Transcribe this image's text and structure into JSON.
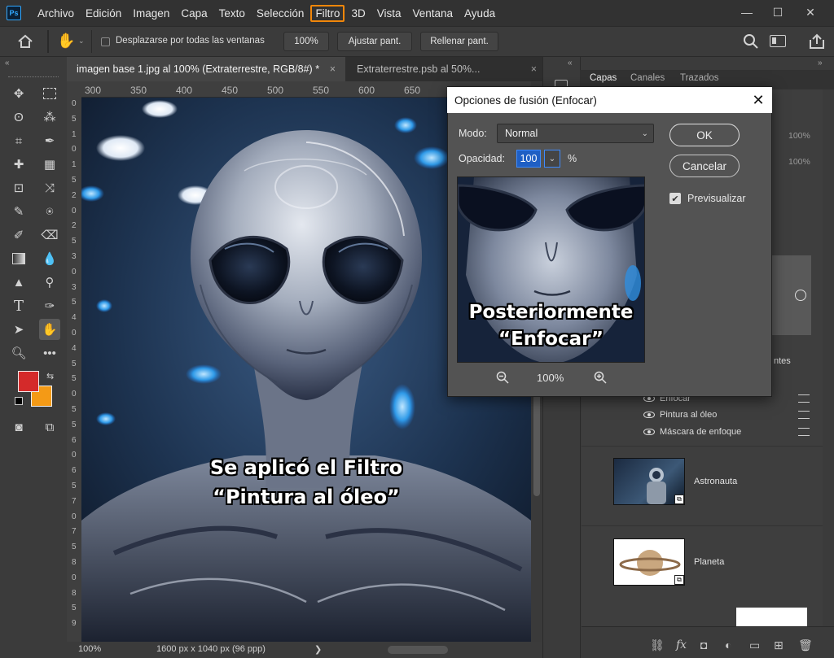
{
  "app": {
    "logo": "Ps",
    "menu": [
      "Archivo",
      "Edición",
      "Imagen",
      "Capa",
      "Texto",
      "Selección",
      "Filtro",
      "3D",
      "Vista",
      "Ventana",
      "Ayuda"
    ],
    "highlighted_menu": "Filtro",
    "window_controls": {
      "minimize": "—",
      "maximize": "☐",
      "close": "✕"
    }
  },
  "options_bar": {
    "scroll_all_label": "Desplazarse por todas las ventanas",
    "zoom_100": "100%",
    "fit_screen": "Ajustar pant.",
    "fill_screen": "Rellenar pant."
  },
  "documents": {
    "tabs": [
      {
        "label": "imagen base 1.jpg al 100% (Extraterrestre, RGB/8#) *",
        "close": "×"
      },
      {
        "label": "Extraterrestre.psb al 50%...",
        "close": "×"
      }
    ]
  },
  "rulers": {
    "h_ticks": [
      "300",
      "350",
      "400",
      "450",
      "500",
      "550",
      "600",
      "650"
    ],
    "v_ticks": [
      "0",
      "5",
      "1",
      "0",
      "1",
      "5",
      "2",
      "0",
      "2",
      "5",
      "3",
      "0",
      "3",
      "5",
      "4",
      "0",
      "4",
      "5",
      "5",
      "0",
      "5",
      "5",
      "6",
      "0",
      "6",
      "5",
      "7",
      "0",
      "7",
      "5",
      "8",
      "0",
      "8",
      "5",
      "9"
    ]
  },
  "canvas": {
    "caption_line1": "Se aplicó el Filtro",
    "caption_line2": "“Pintura al óleo”"
  },
  "status_bar": {
    "zoom": "100%",
    "doc_info": "1600 px x 1040 px (96 ppp)",
    "arrow": "❯"
  },
  "panels": {
    "collapse_left": "«",
    "collapse_mid": "«",
    "collapse_right": "»",
    "tabs": [
      "Capas",
      "Canales",
      "Trazados"
    ],
    "active_tab": "Capas",
    "partial_text_right": "ntes",
    "opacity_partial_1": "100%",
    "opacity_partial_2": "100%",
    "effects": [
      "Enfocar",
      "Pintura al óleo",
      "Máscara de enfoque"
    ],
    "layers": [
      {
        "name": "Astronauta"
      },
      {
        "name": "Planeta"
      }
    ]
  },
  "dialog": {
    "title": "Opciones de fusión (Enfocar)",
    "mode_label": "Modo:",
    "mode_value": "Normal",
    "opacity_label": "Opacidad:",
    "opacity_value": "100",
    "opacity_unit": "%",
    "ok": "OK",
    "cancel": "Cancelar",
    "preview_label": "Previsualizar",
    "preview_checked": true,
    "preview_caption_line1": "Posteriormente",
    "preview_caption_line2": "“Enfocar”",
    "zoom": "100%"
  },
  "colors": {
    "foreground": "#d42a2a",
    "background": "#f49a16",
    "accent": "#f0860a",
    "selection": "#1f5fc4"
  }
}
